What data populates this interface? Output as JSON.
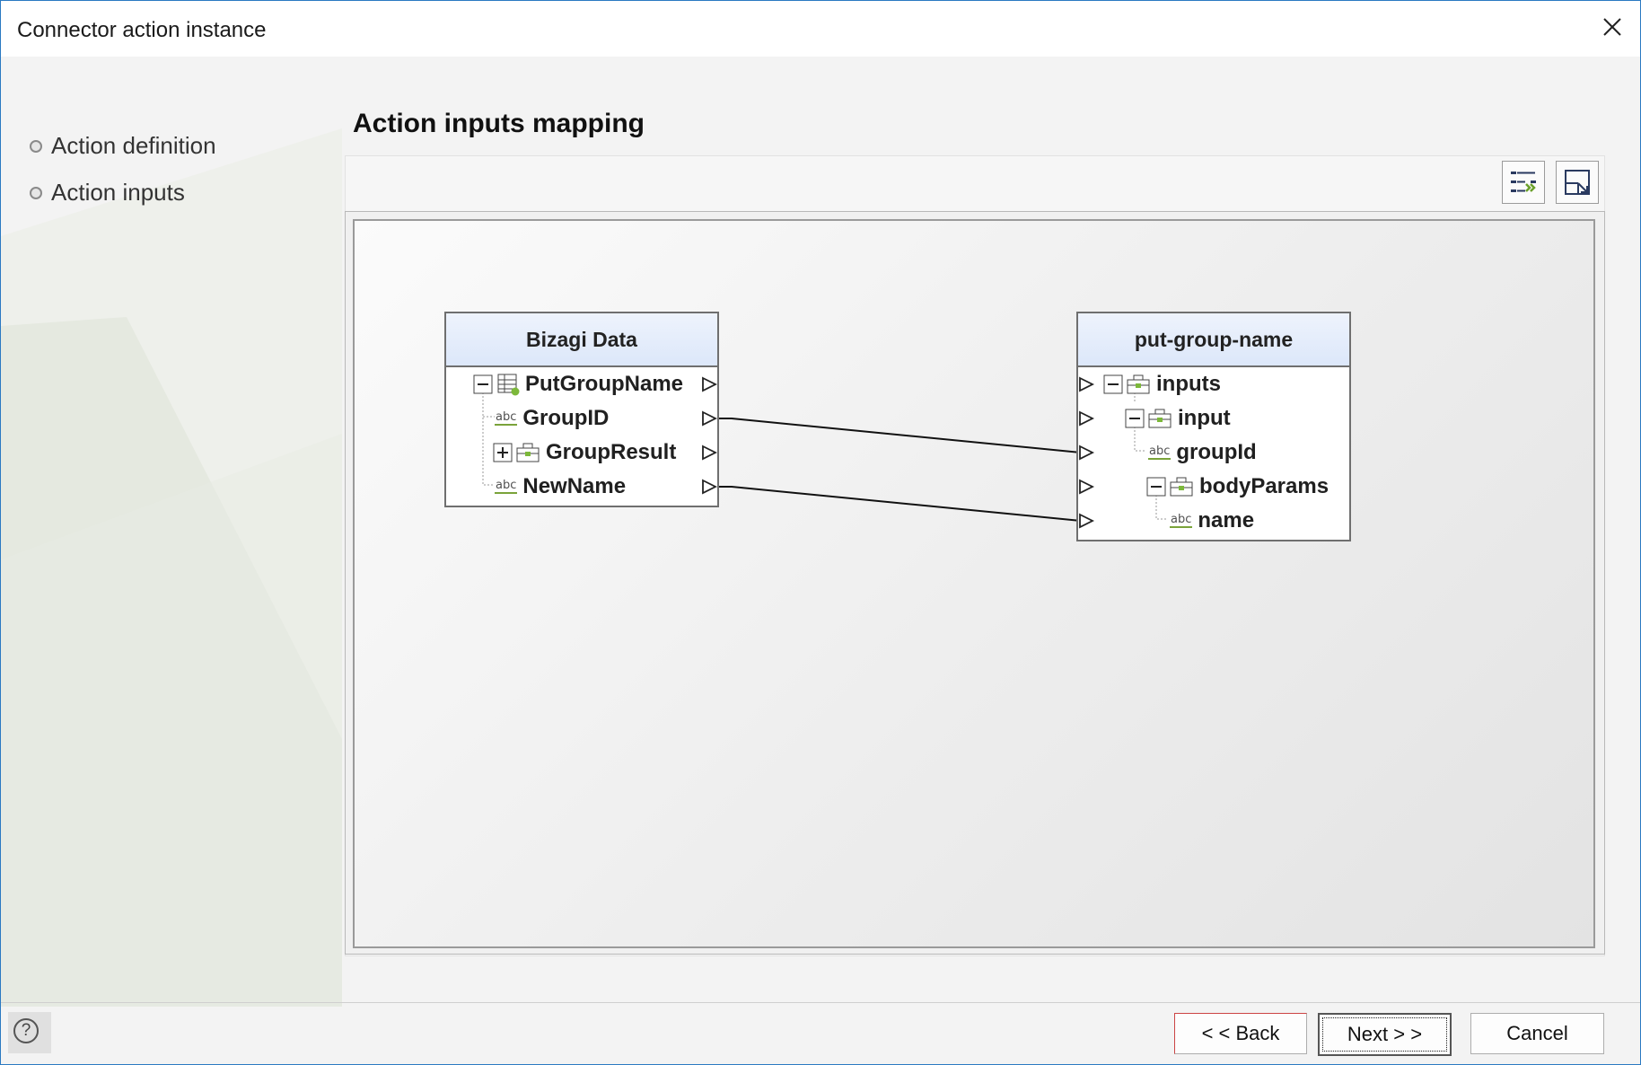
{
  "window": {
    "title": "Connector action instance"
  },
  "nav": {
    "items": [
      {
        "label": "Action definition"
      },
      {
        "label": "Action inputs"
      }
    ]
  },
  "main": {
    "heading": "Action inputs mapping"
  },
  "toolbar": {
    "buttons": [
      {
        "icon": "auto-map-icon"
      },
      {
        "icon": "expand-view-icon"
      }
    ]
  },
  "mapping": {
    "source": {
      "title": "Bizagi Data",
      "rows": [
        {
          "label": "PutGroupName",
          "type": "entity"
        },
        {
          "label": "GroupID",
          "type": "abc",
          "icon_text": "abc"
        },
        {
          "label": "GroupResult",
          "type": "object"
        },
        {
          "label": "NewName",
          "type": "abc",
          "icon_text": "abc"
        }
      ]
    },
    "target": {
      "title": "put-group-name",
      "rows": [
        {
          "label": "inputs",
          "type": "object"
        },
        {
          "label": "input",
          "type": "object"
        },
        {
          "label": "groupId",
          "type": "abc",
          "icon_text": "abc"
        },
        {
          "label": "bodyParams",
          "type": "object"
        },
        {
          "label": "name",
          "type": "abc",
          "icon_text": "abc"
        }
      ]
    },
    "links": [
      {
        "from": "GroupID",
        "to": "groupId"
      },
      {
        "from": "NewName",
        "to": "name"
      }
    ]
  },
  "footer": {
    "help": "?",
    "back": "< < Back",
    "next": "Next > >",
    "cancel": "Cancel"
  }
}
